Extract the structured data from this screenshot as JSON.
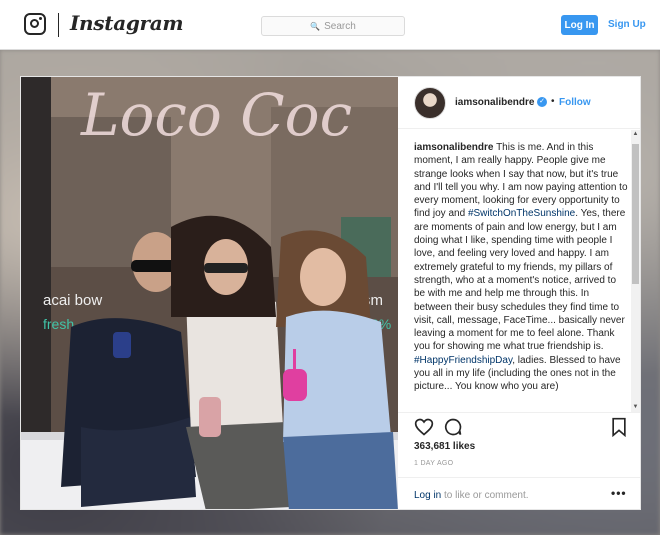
{
  "nav": {
    "wordmark": "Instagram",
    "search_placeholder": "Search",
    "login_label": "Log In",
    "signup_label": "Sign Up"
  },
  "photo": {
    "sign_text": "Loco Coc",
    "window_text_left": "acai bow",
    "window_text_left2": "fresh",
    "window_text_right": "sm",
    "window_text_right2": "0%"
  },
  "post": {
    "username": "iamsonalibendre",
    "separator": "•",
    "follow_label": "Follow",
    "caption": {
      "user": "iamsonalibendre",
      "part1": "This is me. And in this moment, I am really happy. People give me strange looks when I say that now, but it's true and I'll tell you why. I am now paying attention to every moment, looking for every opportunity to find joy and",
      "tag1": "#SwitchOnTheSunshine",
      "part2": ". Yes, there are moments of pain and low energy, but I am doing what I like, spending time with people I love, and feeling very loved and happy. I am extremely grateful to my friends, my pillars of strength, who at a moment's notice, arrived to be with me and help me through this. In between their busy schedules they find time to visit, call, message, FaceTime... basically never leaving a moment for me to feel alone. Thank you for showing me what true friendship is.",
      "tag2": "#HappyFriendshipDay",
      "part3": ", ladies. Blessed to have you all in my life (including the ones not in the picture... You know who you are)"
    },
    "likes": "363,681 likes",
    "time": "1 DAY AGO",
    "comment_login": "Log in",
    "comment_rest": " to like or comment.",
    "more_label": "•••"
  },
  "colors": {
    "accent": "#3897f0",
    "link": "#003569"
  },
  "icons": [
    "instagram-glyph-icon",
    "search-icon",
    "verified-icon",
    "heart-icon",
    "comment-icon",
    "save-icon",
    "more-icon"
  ]
}
